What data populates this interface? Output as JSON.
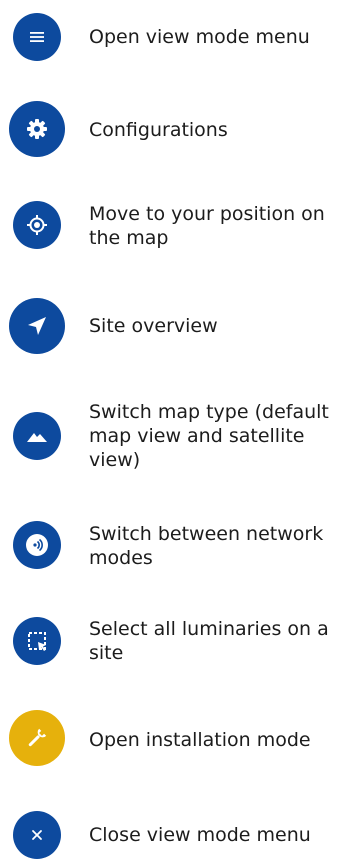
{
  "colors": {
    "primary": "#0d4a9e",
    "accent": "#e6b10c",
    "text": "#1c1c1c"
  },
  "items": [
    {
      "icon": "menu-icon",
      "label": "Open view mode menu"
    },
    {
      "icon": "gear-icon",
      "label": "Configurations"
    },
    {
      "icon": "target-icon",
      "label": "Move to your position on the map"
    },
    {
      "icon": "navigation-arrow-icon",
      "label": "Site overview"
    },
    {
      "icon": "mountain-icon",
      "label": "Switch map type (default map view and satellite view)"
    },
    {
      "icon": "signal-wave-icon",
      "label": "Switch between network modes"
    },
    {
      "icon": "select-all-icon",
      "label": "Select all luminaries on a site"
    },
    {
      "icon": "wrench-icon",
      "label": "Open installation mode"
    },
    {
      "icon": "close-icon",
      "label": "Close view mode menu"
    }
  ]
}
